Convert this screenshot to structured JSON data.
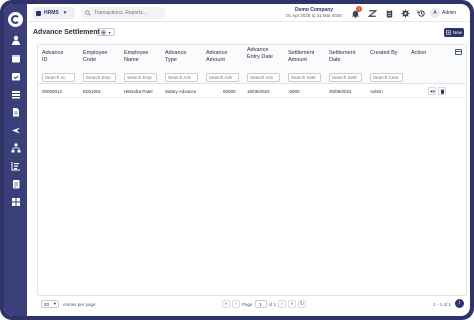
{
  "topbar": {
    "module_label": "HRMS",
    "search_placeholder": "Transactions, Reports...",
    "company_name": "Demo Company",
    "company_period": "01 Apr 2025 to 31 Mar 2026",
    "notification_count": "1",
    "avatar_initial": "A",
    "user_name": "Admin"
  },
  "sidebar": {
    "icons": [
      "person-icon",
      "calendar-icon",
      "calendar-check-icon",
      "money-stack-icon",
      "document-icon",
      "plane-icon",
      "org-chart-icon",
      "bar-list-icon",
      "file-text-icon",
      "grid-icon"
    ]
  },
  "page": {
    "title": "Advance Settlement",
    "new_label": "New"
  },
  "table": {
    "headers": {
      "advance_id": [
        "Advance",
        "ID"
      ],
      "employee_code": [
        "Employee",
        "Code"
      ],
      "employee_name": [
        "Employee",
        "Name"
      ],
      "advance_type": [
        "Advance",
        "Type"
      ],
      "advance_amount": [
        "Advance",
        "Amount"
      ],
      "advance_entry_date": [
        "Advance",
        "Entry Date"
      ],
      "settlement_amount": [
        "Settlement",
        "Amount"
      ],
      "settlement_date": [
        "Settlement",
        "Date"
      ],
      "created_by": [
        "Created By",
        ""
      ],
      "action": [
        "Action",
        ""
      ]
    },
    "filters": {
      "advance_id": "Search Ac",
      "employee_code": "Search Emp",
      "employee_name": "Search Emp",
      "advance_type": "Search Adv",
      "advance_amount": "Search Adv",
      "advance_entry_date": "Search Adv",
      "settlement_amount": "Search Settl",
      "settlement_date": "Search Settl",
      "created_by": "Search Crea"
    },
    "rows": [
      {
        "advance_id": "00000012",
        "employee_code": "E001001",
        "employee_name": "Hitendra Patel",
        "advance_type": "Salary Advance",
        "advance_amount": "60000",
        "advance_entry_date": "18/09/2022",
        "settlement_amount": "-5000",
        "settlement_date": "30/09/2022",
        "created_by": "Admin"
      }
    ]
  },
  "footer": {
    "per_page": "20",
    "per_page_label": "entries per page",
    "page_label": "Page",
    "page_value": "1",
    "of_label": "of 1",
    "range": "1 - 1 of 1",
    "help": "i"
  },
  "colors": {
    "sidebar": "#3a3f7a",
    "frame": "#2f3468",
    "accent": "#2f3468",
    "badge": "#e0522d"
  }
}
